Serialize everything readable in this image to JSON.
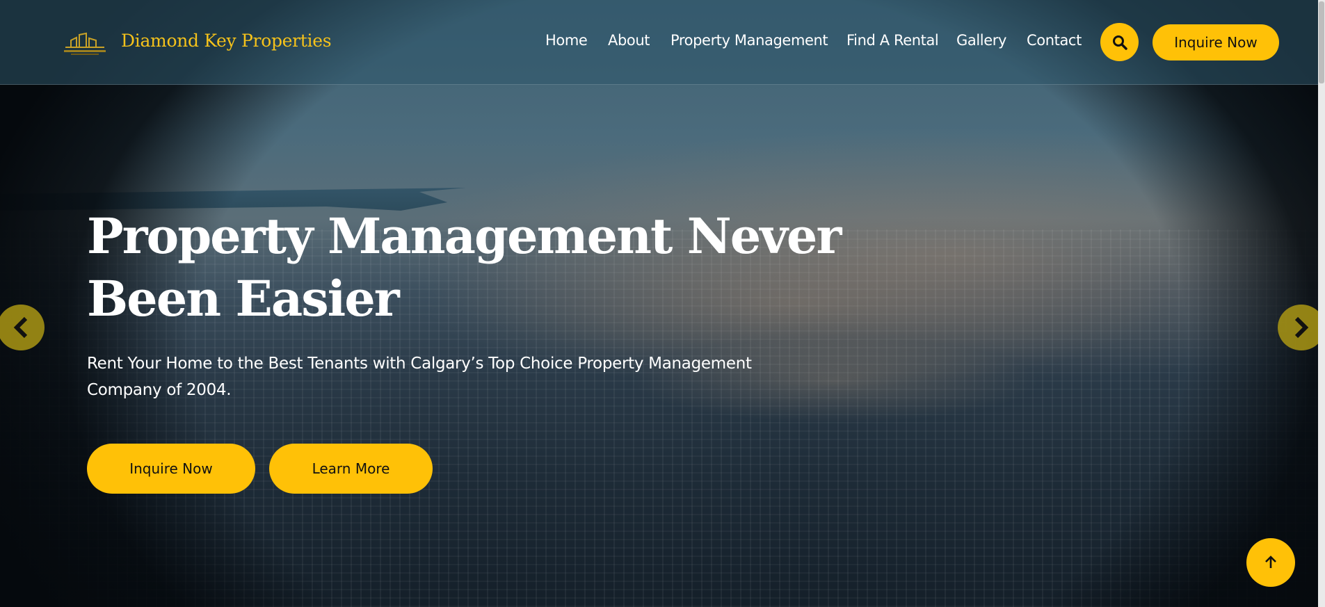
{
  "brand": {
    "name": "Diamond Key Properties",
    "logo_icon": "building-key-logo-icon"
  },
  "nav": {
    "items": [
      {
        "label": "Home"
      },
      {
        "label": "About"
      },
      {
        "label": "Property Management"
      },
      {
        "label": "Find A Rental"
      },
      {
        "label": "Gallery"
      },
      {
        "label": "Contact"
      }
    ],
    "search_icon": "search-icon",
    "cta_label": "Inquire Now"
  },
  "hero": {
    "title": "Property Management Never Been Easier",
    "subtitle": "Rent Your Home to the Best Tenants with Calgary’s Top Choice Property Management Company of 2004.",
    "primary_button": "Inquire Now",
    "secondary_button": "Learn More"
  },
  "controls": {
    "prev_icon": "chevron-left-icon",
    "next_icon": "chevron-right-icon",
    "back_to_top_icon": "arrow-up-icon"
  },
  "colors": {
    "accent": "#ffc107",
    "brand_text": "#f5c21b",
    "text_light": "#ffffff"
  }
}
